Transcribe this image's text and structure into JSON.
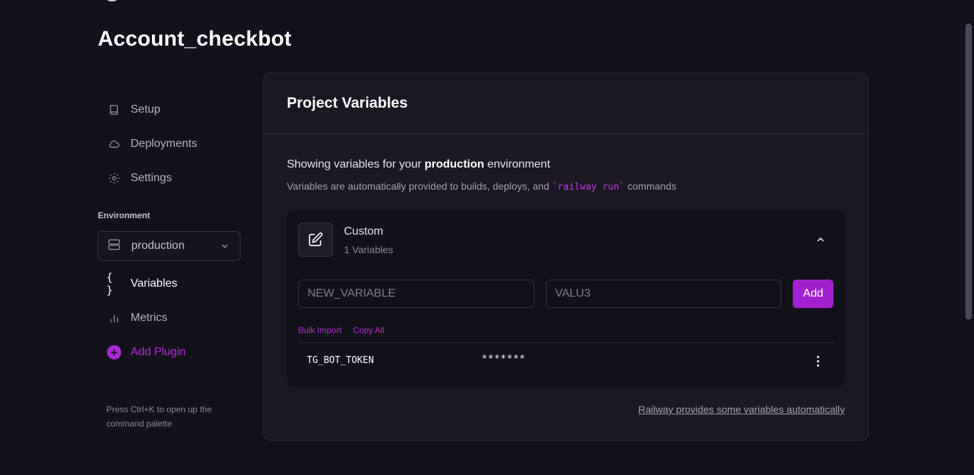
{
  "project": {
    "title": "Account_checkbot"
  },
  "sidebar": {
    "items": [
      {
        "label": "Setup",
        "icon": "book-icon"
      },
      {
        "label": "Deployments",
        "icon": "cloud-icon"
      },
      {
        "label": "Settings",
        "icon": "gear-icon"
      }
    ],
    "environment_label": "Environment",
    "environment_value": "production",
    "items2": [
      {
        "label": "Variables",
        "icon": "braces-icon",
        "glyph": "{ }"
      },
      {
        "label": "Metrics",
        "icon": "bar-chart-icon"
      }
    ],
    "add_plugin": {
      "label": "Add Plugin",
      "glyph": "+"
    },
    "hint": "Press Ctrl+K to open up the command palette"
  },
  "main": {
    "title": "Project Variables",
    "showing_prefix": "Showing variables for your ",
    "environment": "production",
    "showing_suffix": " environment",
    "sub_prefix": "Variables are automatically provided to builds, deploys, and ",
    "sub_code": "`railway run`",
    "sub_suffix": " commands",
    "group": {
      "name": "Custom",
      "count": "1 Variables",
      "name_placeholder": "NEW_VARIABLE",
      "value_placeholder": "VALU3",
      "add_label": "Add",
      "bulk_import": "Bulk Import",
      "copy_all": "Copy All",
      "variables": [
        {
          "key": "TG_BOT_TOKEN",
          "value": "*******"
        }
      ]
    },
    "auto_link": "Railway provides some variables automatically"
  },
  "colors": {
    "background": "#13111c",
    "accent": "#a21fd0",
    "accent_text": "#b52ad8",
    "card": "#1b1723"
  }
}
